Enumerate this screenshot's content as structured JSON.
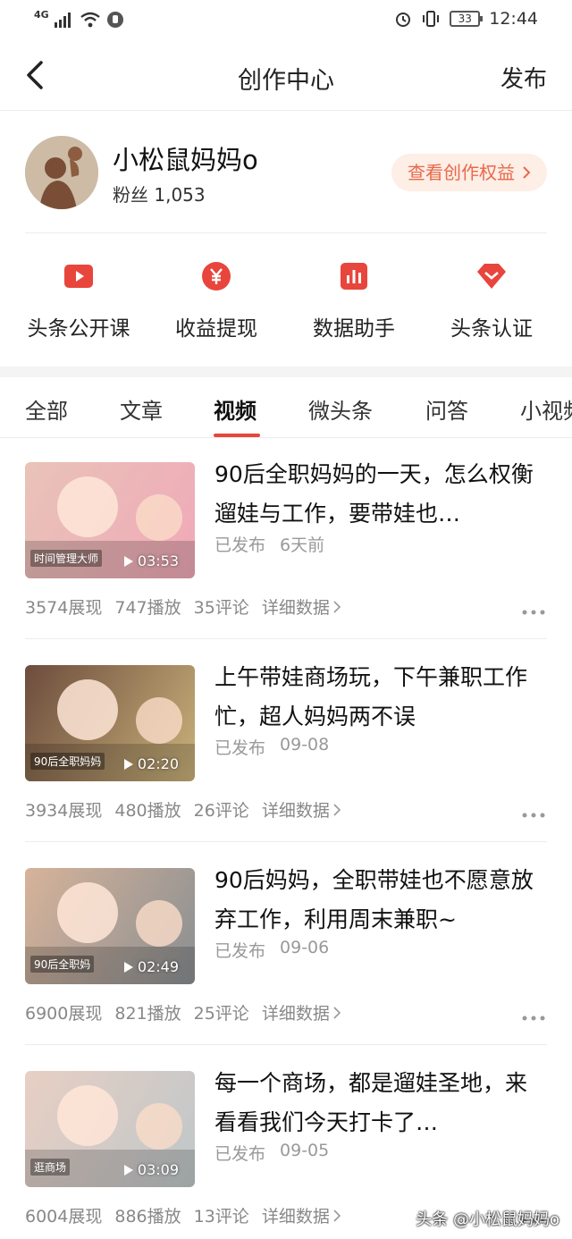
{
  "status_bar": {
    "network": "4G",
    "battery": "33",
    "time": "12:44"
  },
  "nav": {
    "title": "创作中心",
    "publish_label": "发布"
  },
  "profile": {
    "name": "小松鼠妈妈o",
    "fans_label": "粉丝",
    "fans_count": "1,053",
    "rights_label": "查看创作权益"
  },
  "tools": [
    {
      "label": "头条公开课",
      "icon": "play-icon"
    },
    {
      "label": "收益提现",
      "icon": "yuan-icon"
    },
    {
      "label": "数据助手",
      "icon": "chart-icon"
    },
    {
      "label": "头条认证",
      "icon": "badge-icon"
    }
  ],
  "tabs": [
    {
      "label": "全部"
    },
    {
      "label": "文章"
    },
    {
      "label": "视频",
      "active": true
    },
    {
      "label": "微头条"
    },
    {
      "label": "问答"
    },
    {
      "label": "小视频"
    }
  ],
  "items": [
    {
      "title": "90后全职妈妈的一天，怎么权衡遛娃与工作，要带娃也…",
      "status": "已发布",
      "date": "6天前",
      "duration": "03:53",
      "impressions": "3574展现",
      "plays": "747播放",
      "comments": "35评论",
      "detail": "详细数据",
      "thumb_caption": "时间管理大师",
      "thumb_colors": [
        "#e9c3b8",
        "#f0a9b8"
      ]
    },
    {
      "title": "上午带娃商场玩，下午兼职工作忙，超人妈妈两不误",
      "status": "已发布",
      "date": "09-08",
      "duration": "02:20",
      "impressions": "3934展现",
      "plays": "480播放",
      "comments": "26评论",
      "detail": "详细数据",
      "thumb_caption": "90后全职妈妈",
      "thumb_colors": [
        "#6d4c3d",
        "#c9b27a"
      ]
    },
    {
      "title": "90后妈妈，全职带娃也不愿意放弃工作，利用周末兼职~",
      "status": "已发布",
      "date": "09-06",
      "duration": "02:49",
      "impressions": "6900展现",
      "plays": "821播放",
      "comments": "25评论",
      "detail": "详细数据",
      "thumb_caption": "90后全职妈",
      "thumb_colors": [
        "#d7b39a",
        "#8a8f92"
      ]
    },
    {
      "title": "每一个商场，都是遛娃圣地，来看看我们今天打卡了…",
      "status": "已发布",
      "date": "09-05",
      "duration": "03:09",
      "impressions": "6004展现",
      "plays": "886播放",
      "comments": "13评论",
      "detail": "详细数据",
      "thumb_caption": "逛商场",
      "thumb_colors": [
        "#e8cfc4",
        "#bfc7c9"
      ]
    }
  ],
  "watermark": "头条 @小松鼠妈妈o",
  "colors": {
    "accent": "#e8453c",
    "rights_bg": "#fdeee6",
    "rights_text": "#e8694a"
  }
}
